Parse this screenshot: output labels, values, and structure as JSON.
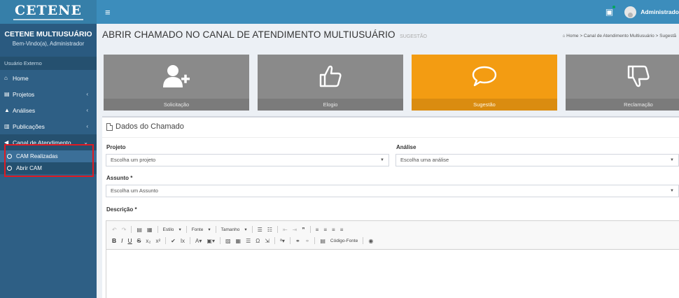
{
  "header": {
    "logo_text": "CETENE",
    "user_label": "Administrado"
  },
  "sidebar": {
    "user_name": "CETENE MULTIUSUÁRIO",
    "welcome": "Bem-Vindo(a), Administrador",
    "section_header": "Usuário Externo",
    "items": [
      {
        "label": "Home",
        "icon": "home-icon"
      },
      {
        "label": "Projetos",
        "icon": "projects-icon"
      },
      {
        "label": "Análises",
        "icon": "flask-icon"
      },
      {
        "label": "Publicações",
        "icon": "document-icon"
      },
      {
        "label": "Canal de Atendimento",
        "icon": "megaphone-icon"
      }
    ],
    "subitems": [
      {
        "label": "CAM Realizadas"
      },
      {
        "label": "Abrir CAM"
      }
    ]
  },
  "page": {
    "title": "ABRIR CHAMADO NO CANAL DE ATENDIMENTO MULTIUSUÁRIO",
    "subtitle": "SUGESTÃO",
    "breadcrumb": "Home > Canal de Atendimento Multiusuário > Sugestã"
  },
  "tiles": [
    {
      "label": "Solicitação",
      "icon": "user-add-icon"
    },
    {
      "label": "Elogio",
      "icon": "thumbs-up-icon"
    },
    {
      "label": "Sugestão",
      "icon": "speech-bubble-icon",
      "selected": true
    },
    {
      "label": "Reclamação",
      "icon": "thumbs-down-icon"
    }
  ],
  "form": {
    "panel_title": "Dados do Chamado",
    "projeto_label": "Projeto",
    "projeto_value": "Escolha um projeto",
    "analise_label": "Análise",
    "analise_value": "Escolha uma análise",
    "assunto_label": "Assunto *",
    "assunto_value": "Escolha um Assunto",
    "descricao_label": "Descrição *"
  },
  "editor": {
    "style_label": "Estilo",
    "font_label": "Fonte",
    "size_label": "Tamanho",
    "source_label": "Código-Fonte"
  },
  "colors": {
    "topbar": "#3c8dbc",
    "sidebar": "#2e5f85",
    "tile_gray": "#8a8a8a",
    "tile_selected": "#f39c12",
    "highlight": "#e01a22"
  }
}
